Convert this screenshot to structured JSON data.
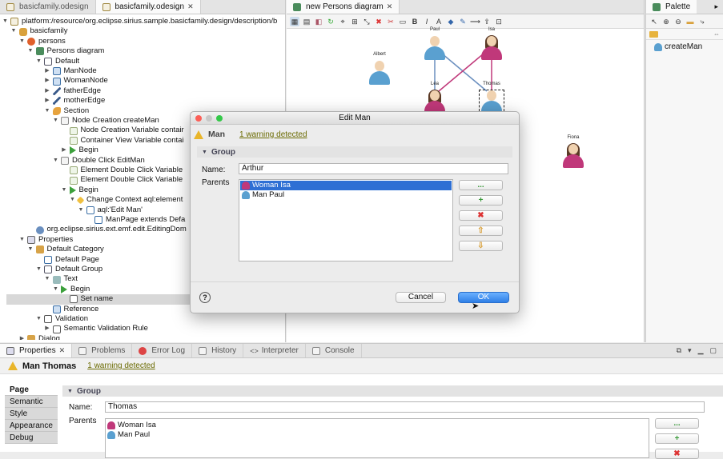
{
  "left_editor": {
    "tabs": [
      {
        "label": "basicfamily.odesign",
        "active": false
      },
      {
        "label": "basicfamily.odesign",
        "active": true
      }
    ],
    "tree": [
      {
        "depth": 0,
        "twisty": "open",
        "icon": "file",
        "label": "platform:/resource/org.eclipse.sirius.sample.basicfamily.design/description/b"
      },
      {
        "depth": 1,
        "twisty": "open",
        "icon": "pkg",
        "label": "basicfamily"
      },
      {
        "depth": 2,
        "twisty": "open",
        "icon": "persons",
        "label": "persons"
      },
      {
        "depth": 3,
        "twisty": "open",
        "icon": "diag",
        "label": "Persons diagram"
      },
      {
        "depth": 4,
        "twisty": "open",
        "icon": "layer",
        "label": "Default"
      },
      {
        "depth": 5,
        "twisty": "closed",
        "icon": "node",
        "label": "ManNode"
      },
      {
        "depth": 5,
        "twisty": "closed",
        "icon": "node",
        "label": "WomanNode"
      },
      {
        "depth": 5,
        "twisty": "closed",
        "icon": "edge",
        "label": "fatherEdge"
      },
      {
        "depth": 5,
        "twisty": "closed",
        "icon": "edge",
        "label": "motherEdge"
      },
      {
        "depth": 5,
        "twisty": "open",
        "icon": "section",
        "label": "Section"
      },
      {
        "depth": 6,
        "twisty": "open",
        "icon": "tool",
        "label": "Node Creation createMan"
      },
      {
        "depth": 7,
        "twisty": "none",
        "icon": "var",
        "label": "Node Creation Variable contair"
      },
      {
        "depth": 7,
        "twisty": "none",
        "icon": "var",
        "label": "Container View Variable contai"
      },
      {
        "depth": 7,
        "twisty": "closed",
        "icon": "begin",
        "label": "Begin"
      },
      {
        "depth": 6,
        "twisty": "open",
        "icon": "tool",
        "label": "Double Click EditMan"
      },
      {
        "depth": 7,
        "twisty": "none",
        "icon": "var",
        "label": "Element Double Click Variable"
      },
      {
        "depth": 7,
        "twisty": "none",
        "icon": "var",
        "label": "Element Double Click Variable"
      },
      {
        "depth": 7,
        "twisty": "open",
        "icon": "begin",
        "label": "Begin"
      },
      {
        "depth": 8,
        "twisty": "open",
        "icon": "ctx",
        "label": "Change Context aql:element"
      },
      {
        "depth": 9,
        "twisty": "open",
        "icon": "page",
        "label": "aql:'Edit Man'"
      },
      {
        "depth": 10,
        "twisty": "none",
        "icon": "page",
        "label": "ManPage extends Defa"
      },
      {
        "depth": 3,
        "twisty": "none",
        "icon": "ext",
        "label": "org.eclipse.sirius.ext.emf.edit.EditingDom"
      },
      {
        "depth": 2,
        "twisty": "open",
        "icon": "prop",
        "label": "Properties"
      },
      {
        "depth": 3,
        "twisty": "open",
        "icon": "cat",
        "label": "Default Category"
      },
      {
        "depth": 4,
        "twisty": "none",
        "icon": "page",
        "label": "Default Page"
      },
      {
        "depth": 4,
        "twisty": "open",
        "icon": "layer",
        "label": "Default Group"
      },
      {
        "depth": 5,
        "twisty": "open",
        "icon": "textic",
        "label": "Text"
      },
      {
        "depth": 6,
        "twisty": "open",
        "icon": "begin",
        "label": "Begin"
      },
      {
        "depth": 7,
        "twisty": "none",
        "icon": "setic",
        "label": "Set name",
        "selected": true
      },
      {
        "depth": 5,
        "twisty": "none",
        "icon": "node",
        "label": "Reference"
      },
      {
        "depth": 4,
        "twisty": "open",
        "icon": "check",
        "label": "Validation"
      },
      {
        "depth": 5,
        "twisty": "closed",
        "icon": "check",
        "label": "Semantic Validation Rule"
      },
      {
        "depth": 2,
        "twisty": "closed",
        "icon": "cat",
        "label": "Dialog"
      }
    ]
  },
  "diagram_editor": {
    "tab_label": "new Persons diagram",
    "persons": [
      {
        "id": "paul",
        "label": "Paul",
        "kind": "man"
      },
      {
        "id": "isa",
        "label": "Isa",
        "kind": "woman"
      },
      {
        "id": "albert",
        "label": "Albert",
        "kind": "man"
      },
      {
        "id": "lea",
        "label": "Léa",
        "kind": "woman"
      },
      {
        "id": "thomas",
        "label": "Thomas",
        "kind": "man",
        "selected": true
      },
      {
        "id": "fiona",
        "label": "Fiona",
        "kind": "woman"
      }
    ]
  },
  "palette": {
    "title": "Palette",
    "items": [
      {
        "label": "createMan"
      }
    ]
  },
  "dialog": {
    "title": "Edit Man",
    "header_title": "Man",
    "warning_link": "1 warning detected",
    "group_label": "Group",
    "name_label": "Name:",
    "name_value": "Arthur",
    "parents_label": "Parents",
    "parents": [
      {
        "label": "Woman Isa",
        "kind": "woman",
        "selected": true
      },
      {
        "label": "Man Paul",
        "kind": "man",
        "selected": false
      }
    ],
    "side_buttons": [
      "...",
      "+",
      "✖",
      "⇧",
      "⇩"
    ],
    "cancel_label": "Cancel",
    "ok_label": "OK",
    "help_label": "?"
  },
  "bottom_panel": {
    "tabs": [
      "Properties",
      "Problems",
      "Error Log",
      "History",
      "Interpreter",
      "Console"
    ],
    "header_title": "Man Thomas",
    "warning_link": "1 warning detected",
    "side_tabs": [
      "Page",
      "Semantic",
      "Style",
      "Appearance",
      "Debug"
    ],
    "group_label": "Group",
    "name_label": "Name:",
    "name_value": "Thomas",
    "parents_label": "Parents",
    "parents": [
      {
        "label": "Woman Isa",
        "kind": "woman"
      },
      {
        "label": "Man Paul",
        "kind": "man"
      }
    ],
    "side_buttons": [
      "...",
      "+",
      "✖"
    ]
  },
  "colors": {
    "selection": "#2e6fd4",
    "warning": "#e9b52a",
    "link": "#6a6a00",
    "ok_button": "#3b8be8"
  }
}
